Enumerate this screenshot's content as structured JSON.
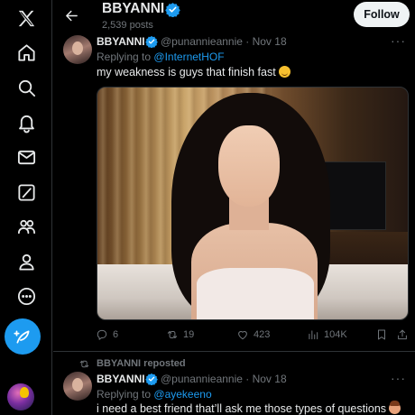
{
  "header": {
    "name": "BBYANNI",
    "posts_count": "2,539 posts",
    "follow_label": "Follow"
  },
  "nav": {
    "items": [
      "x-logo-icon",
      "home-icon",
      "explore-icon",
      "notifications-icon",
      "messages-icon",
      "grok-icon",
      "communities-icon",
      "profile-icon",
      "more-icon",
      "compose-icon"
    ]
  },
  "tweet1": {
    "name": "BBYANNI",
    "handle_time": "@punannieannie · Nov 18",
    "reply_prefix": "Replying to",
    "reply_mention": "@InternetHOF",
    "text": "my weakness is guys that finish fast",
    "more": "···",
    "replies": "6",
    "reposts": "19",
    "likes": "423",
    "views": "104K"
  },
  "repost_note": "BBYANNI reposted",
  "tweet2": {
    "name": "BBYANNI",
    "handle_time": "@punannieannie · Nov 18",
    "reply_prefix": "Replying to",
    "reply_mention": "@ayekeeno",
    "text": "i need a best friend that’ll ask me those types of questions",
    "more": "···"
  },
  "colors": {
    "accent": "#1d9bf0",
    "background": "#000000",
    "text": "#e7e9ea",
    "muted": "#71767b",
    "border": "#2f3336"
  }
}
